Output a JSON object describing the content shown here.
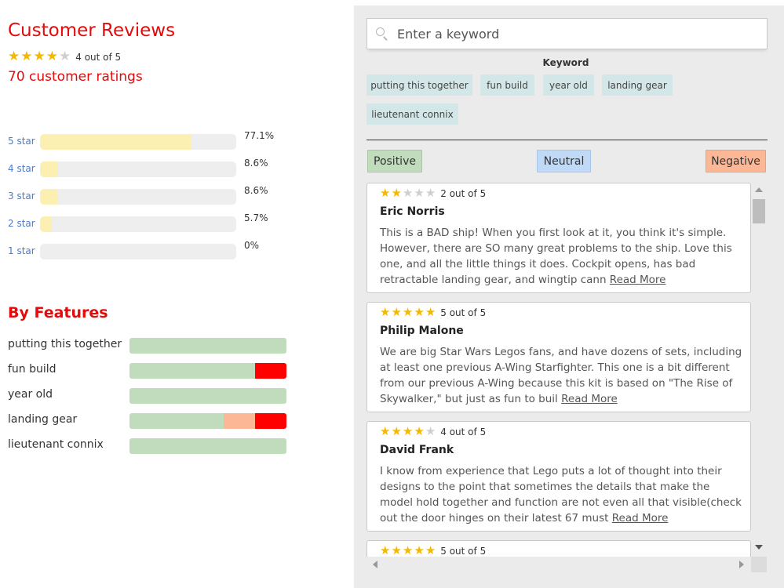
{
  "summary": {
    "title": "Customer Reviews",
    "rating": 4,
    "rating_text": "4 out of 5",
    "ratings_count": "70 customer ratings"
  },
  "histogram": [
    {
      "label": "5 star",
      "percent": 77.1,
      "percent_text": "77.1%"
    },
    {
      "label": "4 star",
      "percent": 8.6,
      "percent_text": "8.6%"
    },
    {
      "label": "3 star",
      "percent": 8.6,
      "percent_text": "8.6%"
    },
    {
      "label": "2 star",
      "percent": 5.7,
      "percent_text": "5.7%"
    },
    {
      "label": "1 star",
      "percent": 0,
      "percent_text": "0%"
    }
  ],
  "features": {
    "title": "By Features",
    "items": [
      {
        "label": "putting this together",
        "positive": 1.0,
        "neutral": 0.0,
        "negative": 0.0
      },
      {
        "label": "fun build",
        "positive": 0.8,
        "neutral": 0.0,
        "negative": 0.2
      },
      {
        "label": "year old",
        "positive": 1.0,
        "neutral": 0.0,
        "negative": 0.0
      },
      {
        "label": "landing gear",
        "positive": 0.6,
        "neutral": 0.2,
        "negative": 0.2
      },
      {
        "label": "lieutenant connix",
        "positive": 1.0,
        "neutral": 0.0,
        "negative": 0.0
      }
    ]
  },
  "search": {
    "placeholder": "Enter a keyword",
    "value": ""
  },
  "keywords": {
    "heading": "Keyword",
    "chips": [
      "putting this together",
      "fun build",
      "year old",
      "landing gear",
      "lieutenant connix"
    ]
  },
  "sentiment": {
    "positive": "Positive",
    "neutral": "Neutral",
    "negative": "Negative"
  },
  "reviews": [
    {
      "rating": 2,
      "rating_text": "2 out of 5",
      "author": "Eric Norris",
      "body": "This is a BAD ship! When you first look at it, you think it's simple. However, there are SO many great problems to the ship. Love this one, and all the little things it does. Cockpit opens, has bad retractable landing gear, and wingtip cann",
      "read_more": "Read More"
    },
    {
      "rating": 5,
      "rating_text": "5 out of 5",
      "author": "Philip Malone",
      "body": "We are big Star Wars Legos fans, and have dozens of sets, including at least one previous A-Wing Starfighter. This one is a bit different from our previous A-Wing because this kit is based on \"The Rise of Skywalker,\" but just as fun to buil",
      "read_more": "Read More"
    },
    {
      "rating": 4,
      "rating_text": "4 out of 5",
      "author": "David Frank",
      "body": "I know from experience that Lego puts a lot of thought into their designs to the point that sometimes the details that make the model hold together and function are not even all that visible(check out the door hinges on their latest 67 must",
      "read_more": "Read More"
    },
    {
      "rating": 5,
      "rating_text": "5 out of 5",
      "author": "",
      "body": "",
      "read_more": ""
    }
  ],
  "icons": {
    "search": "search-icon",
    "star": "star-icon",
    "scroll_up": "scroll-up-arrow-icon",
    "scroll_down": "scroll-down-arrow-icon",
    "scroll_left": "scroll-left-arrow-icon",
    "scroll_right": "scroll-right-arrow-icon"
  },
  "colors": {
    "accent_red": "#e30b0b",
    "star_gold": "#f5b800",
    "histogram_fill": "#fbefb1",
    "positive": "#c0dcbd",
    "neutral": "#bfd9f7",
    "negative": "#ff0000",
    "mixed": "#fcb896",
    "chip": "#d3e7e8",
    "link_blue": "#4a7bd0"
  }
}
